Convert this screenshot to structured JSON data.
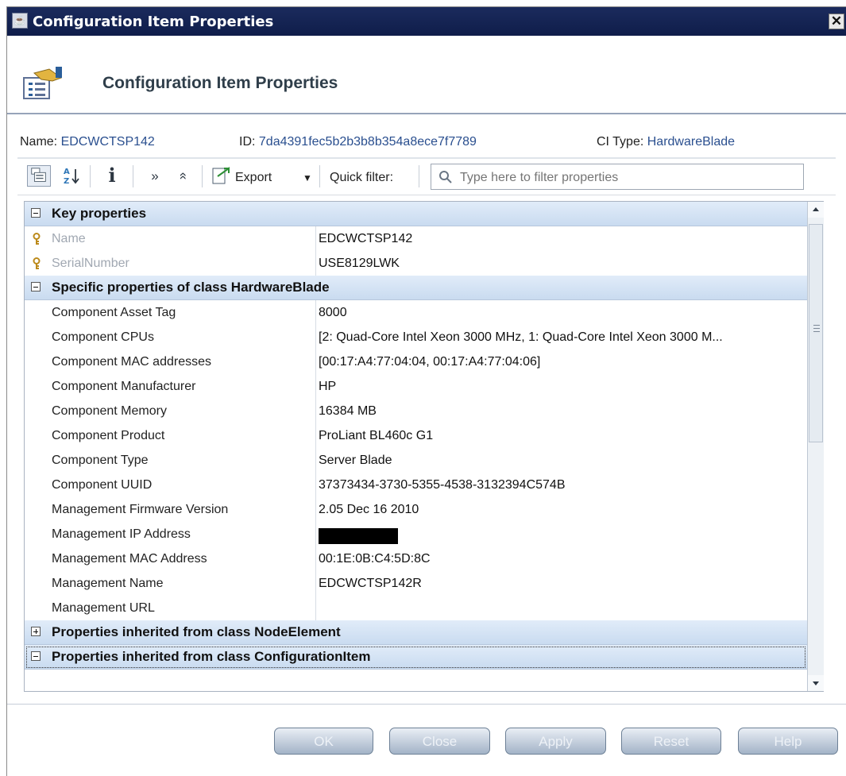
{
  "window": {
    "title": "Configuration Item Properties",
    "close_glyph": "✕"
  },
  "header": {
    "title": "Configuration Item Properties",
    "icon": "properties-form-icon"
  },
  "info": {
    "name_label": "Name:",
    "name_value": "EDCWCTSP142",
    "id_label": "ID:",
    "id_value": "7da4391fec5b2b3b8b354a8ece7f7789",
    "ci_type_label": "CI Type:",
    "ci_type_value": "HardwareBlade"
  },
  "toolbar": {
    "export_label": "Export",
    "quick_filter_label": "Quick filter:",
    "quick_filter_placeholder": "Type here to filter properties"
  },
  "groups": {
    "key": "Key properties",
    "specific": "Specific properties of class HardwareBlade",
    "inherited_node": "Properties inherited from class NodeElement",
    "inherited_ci": "Properties inherited from class ConfigurationItem"
  },
  "key_properties": [
    {
      "name": "Name",
      "value": "EDCWCTSP142"
    },
    {
      "name": "SerialNumber",
      "value": "USE8129LWK"
    }
  ],
  "specific_properties": [
    {
      "name": "Component Asset Tag",
      "value": "8000"
    },
    {
      "name": "Component CPUs",
      "value": "[2: Quad-Core Intel Xeon 3000 MHz, 1: Quad-Core Intel Xeon 3000 M..."
    },
    {
      "name": "Component MAC addresses",
      "value": "[00:17:A4:77:04:04, 00:17:A4:77:04:06]"
    },
    {
      "name": "Component Manufacturer",
      "value": "HP"
    },
    {
      "name": "Component Memory",
      "value": "16384 MB"
    },
    {
      "name": "Component Product",
      "value": "ProLiant BL460c G1"
    },
    {
      "name": "Component Type",
      "value": "Server Blade"
    },
    {
      "name": "Component UUID",
      "value": "37373434-3730-5355-4538-3132394C574B"
    },
    {
      "name": "Management Firmware Version",
      "value": "2.05 Dec 16 2010"
    },
    {
      "name": "Management IP Address",
      "value": ""
    },
    {
      "name": "Management MAC Address",
      "value": "00:1E:0B:C4:5D:8C"
    },
    {
      "name": "Management Name",
      "value": "EDCWCTSP142R"
    },
    {
      "name": "Management URL",
      "value": ""
    }
  ],
  "buttons": {
    "ok": "OK",
    "close": "Close",
    "apply": "Apply",
    "reset": "Reset",
    "help": "Help"
  },
  "colors": {
    "title_bar": "#0f1d4a",
    "link_value": "#2a4f8f",
    "group_header": "#c9dbf0",
    "button": "#a3b3c7"
  }
}
